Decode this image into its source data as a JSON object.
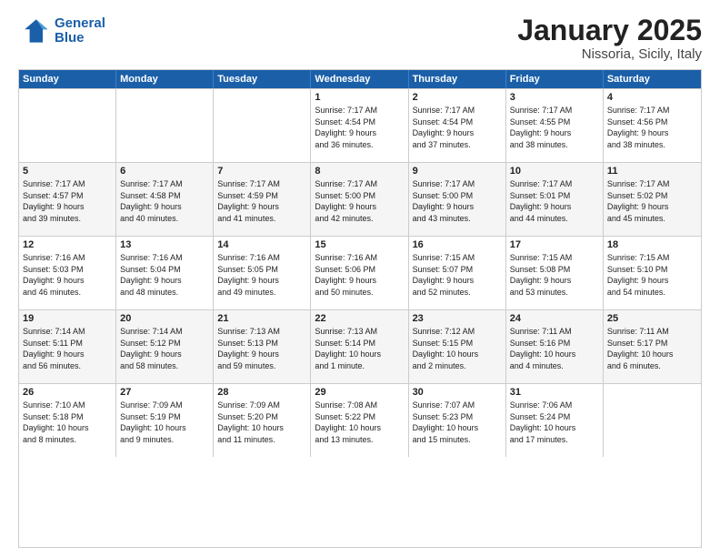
{
  "header": {
    "logo_line1": "General",
    "logo_line2": "Blue",
    "month_title": "January 2025",
    "location": "Nissoria, Sicily, Italy"
  },
  "weekdays": [
    "Sunday",
    "Monday",
    "Tuesday",
    "Wednesday",
    "Thursday",
    "Friday",
    "Saturday"
  ],
  "weeks": [
    [
      {
        "day": "",
        "info": ""
      },
      {
        "day": "",
        "info": ""
      },
      {
        "day": "",
        "info": ""
      },
      {
        "day": "1",
        "info": "Sunrise: 7:17 AM\nSunset: 4:54 PM\nDaylight: 9 hours\nand 36 minutes."
      },
      {
        "day": "2",
        "info": "Sunrise: 7:17 AM\nSunset: 4:54 PM\nDaylight: 9 hours\nand 37 minutes."
      },
      {
        "day": "3",
        "info": "Sunrise: 7:17 AM\nSunset: 4:55 PM\nDaylight: 9 hours\nand 38 minutes."
      },
      {
        "day": "4",
        "info": "Sunrise: 7:17 AM\nSunset: 4:56 PM\nDaylight: 9 hours\nand 38 minutes."
      }
    ],
    [
      {
        "day": "5",
        "info": "Sunrise: 7:17 AM\nSunset: 4:57 PM\nDaylight: 9 hours\nand 39 minutes."
      },
      {
        "day": "6",
        "info": "Sunrise: 7:17 AM\nSunset: 4:58 PM\nDaylight: 9 hours\nand 40 minutes."
      },
      {
        "day": "7",
        "info": "Sunrise: 7:17 AM\nSunset: 4:59 PM\nDaylight: 9 hours\nand 41 minutes."
      },
      {
        "day": "8",
        "info": "Sunrise: 7:17 AM\nSunset: 5:00 PM\nDaylight: 9 hours\nand 42 minutes."
      },
      {
        "day": "9",
        "info": "Sunrise: 7:17 AM\nSunset: 5:00 PM\nDaylight: 9 hours\nand 43 minutes."
      },
      {
        "day": "10",
        "info": "Sunrise: 7:17 AM\nSunset: 5:01 PM\nDaylight: 9 hours\nand 44 minutes."
      },
      {
        "day": "11",
        "info": "Sunrise: 7:17 AM\nSunset: 5:02 PM\nDaylight: 9 hours\nand 45 minutes."
      }
    ],
    [
      {
        "day": "12",
        "info": "Sunrise: 7:16 AM\nSunset: 5:03 PM\nDaylight: 9 hours\nand 46 minutes."
      },
      {
        "day": "13",
        "info": "Sunrise: 7:16 AM\nSunset: 5:04 PM\nDaylight: 9 hours\nand 48 minutes."
      },
      {
        "day": "14",
        "info": "Sunrise: 7:16 AM\nSunset: 5:05 PM\nDaylight: 9 hours\nand 49 minutes."
      },
      {
        "day": "15",
        "info": "Sunrise: 7:16 AM\nSunset: 5:06 PM\nDaylight: 9 hours\nand 50 minutes."
      },
      {
        "day": "16",
        "info": "Sunrise: 7:15 AM\nSunset: 5:07 PM\nDaylight: 9 hours\nand 52 minutes."
      },
      {
        "day": "17",
        "info": "Sunrise: 7:15 AM\nSunset: 5:08 PM\nDaylight: 9 hours\nand 53 minutes."
      },
      {
        "day": "18",
        "info": "Sunrise: 7:15 AM\nSunset: 5:10 PM\nDaylight: 9 hours\nand 54 minutes."
      }
    ],
    [
      {
        "day": "19",
        "info": "Sunrise: 7:14 AM\nSunset: 5:11 PM\nDaylight: 9 hours\nand 56 minutes."
      },
      {
        "day": "20",
        "info": "Sunrise: 7:14 AM\nSunset: 5:12 PM\nDaylight: 9 hours\nand 58 minutes."
      },
      {
        "day": "21",
        "info": "Sunrise: 7:13 AM\nSunset: 5:13 PM\nDaylight: 9 hours\nand 59 minutes."
      },
      {
        "day": "22",
        "info": "Sunrise: 7:13 AM\nSunset: 5:14 PM\nDaylight: 10 hours\nand 1 minute."
      },
      {
        "day": "23",
        "info": "Sunrise: 7:12 AM\nSunset: 5:15 PM\nDaylight: 10 hours\nand 2 minutes."
      },
      {
        "day": "24",
        "info": "Sunrise: 7:11 AM\nSunset: 5:16 PM\nDaylight: 10 hours\nand 4 minutes."
      },
      {
        "day": "25",
        "info": "Sunrise: 7:11 AM\nSunset: 5:17 PM\nDaylight: 10 hours\nand 6 minutes."
      }
    ],
    [
      {
        "day": "26",
        "info": "Sunrise: 7:10 AM\nSunset: 5:18 PM\nDaylight: 10 hours\nand 8 minutes."
      },
      {
        "day": "27",
        "info": "Sunrise: 7:09 AM\nSunset: 5:19 PM\nDaylight: 10 hours\nand 9 minutes."
      },
      {
        "day": "28",
        "info": "Sunrise: 7:09 AM\nSunset: 5:20 PM\nDaylight: 10 hours\nand 11 minutes."
      },
      {
        "day": "29",
        "info": "Sunrise: 7:08 AM\nSunset: 5:22 PM\nDaylight: 10 hours\nand 13 minutes."
      },
      {
        "day": "30",
        "info": "Sunrise: 7:07 AM\nSunset: 5:23 PM\nDaylight: 10 hours\nand 15 minutes."
      },
      {
        "day": "31",
        "info": "Sunrise: 7:06 AM\nSunset: 5:24 PM\nDaylight: 10 hours\nand 17 minutes."
      },
      {
        "day": "",
        "info": ""
      }
    ]
  ]
}
